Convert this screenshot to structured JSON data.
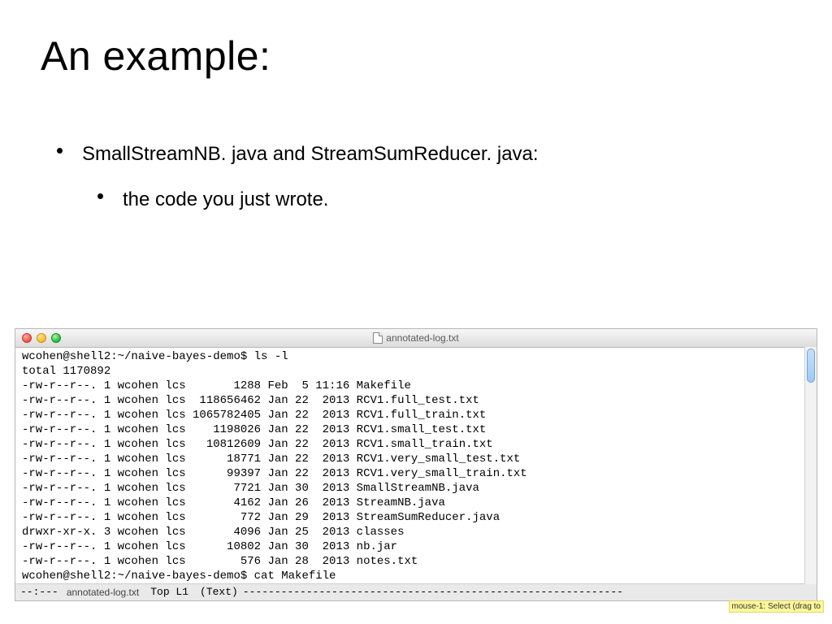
{
  "title": "An example:",
  "bullets": {
    "level1": "SmallStreamNB. java and StreamSumReducer. java:",
    "level2": "the code you just wrote."
  },
  "terminal": {
    "window_title": "annotated-log.txt",
    "prompt1": "wcohen@shell2:~/naive-bayes-demo$ ls -l",
    "prompt2": "wcohen@shell2:~/naive-bayes-demo$ cat Makefile",
    "total": "total 1170892",
    "listing": [
      {
        "perm": "-rw-r--r--.",
        "links": "1",
        "user": "wcohen",
        "group": "lcs",
        "size": "1288",
        "date": "Feb  5 11:16",
        "name": "Makefile"
      },
      {
        "perm": "-rw-r--r--.",
        "links": "1",
        "user": "wcohen",
        "group": "lcs",
        "size": "118656462",
        "date": "Jan 22  2013",
        "name": "RCV1.full_test.txt"
      },
      {
        "perm": "-rw-r--r--.",
        "links": "1",
        "user": "wcohen",
        "group": "lcs",
        "size": "1065782405",
        "date": "Jan 22  2013",
        "name": "RCV1.full_train.txt"
      },
      {
        "perm": "-rw-r--r--.",
        "links": "1",
        "user": "wcohen",
        "group": "lcs",
        "size": "1198026",
        "date": "Jan 22  2013",
        "name": "RCV1.small_test.txt"
      },
      {
        "perm": "-rw-r--r--.",
        "links": "1",
        "user": "wcohen",
        "group": "lcs",
        "size": "10812609",
        "date": "Jan 22  2013",
        "name": "RCV1.small_train.txt"
      },
      {
        "perm": "-rw-r--r--.",
        "links": "1",
        "user": "wcohen",
        "group": "lcs",
        "size": "18771",
        "date": "Jan 22  2013",
        "name": "RCV1.very_small_test.txt"
      },
      {
        "perm": "-rw-r--r--.",
        "links": "1",
        "user": "wcohen",
        "group": "lcs",
        "size": "99397",
        "date": "Jan 22  2013",
        "name": "RCV1.very_small_train.txt"
      },
      {
        "perm": "-rw-r--r--.",
        "links": "1",
        "user": "wcohen",
        "group": "lcs",
        "size": "7721",
        "date": "Jan 30  2013",
        "name": "SmallStreamNB.java"
      },
      {
        "perm": "-rw-r--r--.",
        "links": "1",
        "user": "wcohen",
        "group": "lcs",
        "size": "4162",
        "date": "Jan 26  2013",
        "name": "StreamNB.java"
      },
      {
        "perm": "-rw-r--r--.",
        "links": "1",
        "user": "wcohen",
        "group": "lcs",
        "size": "772",
        "date": "Jan 29  2013",
        "name": "StreamSumReducer.java"
      },
      {
        "perm": "drwxr-xr-x.",
        "links": "3",
        "user": "wcohen",
        "group": "lcs",
        "size": "4096",
        "date": "Jan 25  2013",
        "name": "classes"
      },
      {
        "perm": "-rw-r--r--.",
        "links": "1",
        "user": "wcohen",
        "group": "lcs",
        "size": "10802",
        "date": "Jan 30  2013",
        "name": "nb.jar"
      },
      {
        "perm": "-rw-r--r--.",
        "links": "1",
        "user": "wcohen",
        "group": "lcs",
        "size": "576",
        "date": "Jan 28  2013",
        "name": "notes.txt"
      }
    ],
    "statusbar": {
      "left": "--:---",
      "filename": "annotated-log.txt",
      "mid": "Top L1",
      "mode": "(Text)"
    },
    "tooltip": "mouse-1: Select (drag to"
  }
}
